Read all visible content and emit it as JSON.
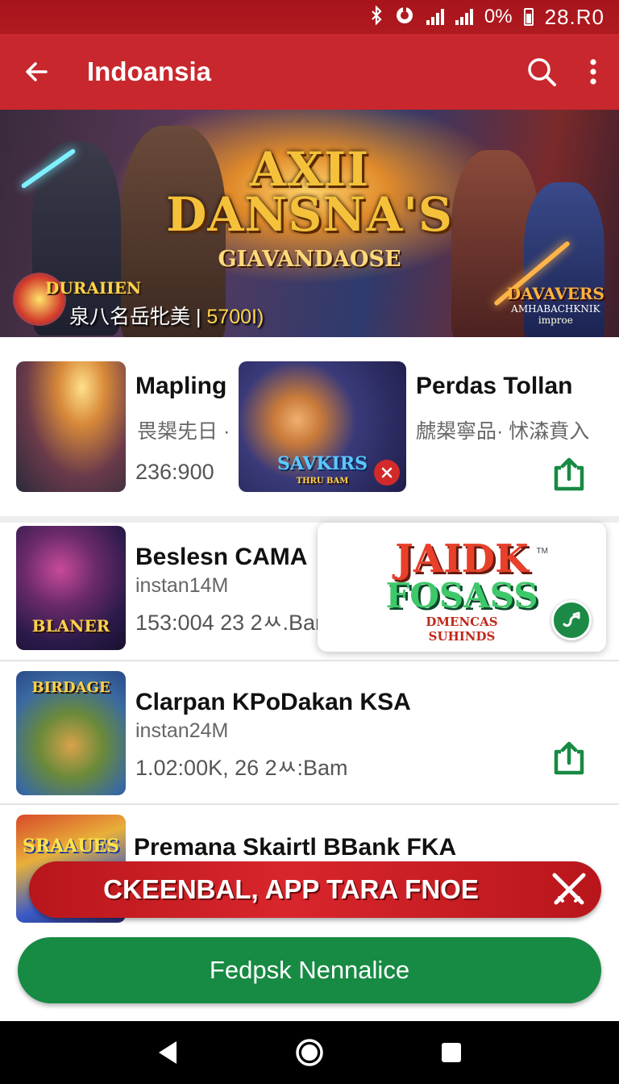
{
  "status_bar": {
    "battery": "0%",
    "time": "28.R0"
  },
  "app_bar": {
    "title": "Indoansia"
  },
  "hero": {
    "title_line1": "AXII",
    "title_line2": "DANSNA'S",
    "subtitle": "GIAVANDAOSE",
    "logo_text": "DURAIIEN",
    "caption_prefix": "泉八名岳牝美 | ",
    "caption_number": "5700I)",
    "right_logo_line1": "DAVAVERS",
    "right_logo_line2": "AMHABACHKNIK",
    "right_logo_line3": "improe"
  },
  "apps": [
    {
      "name": "Mapling",
      "sub": "畏槼兂日 ·",
      "meta": "236:900"
    },
    {
      "name": "Perdas Tollan",
      "sub": "虤槼寧品· 怵潹賁入",
      "thumb_label": "SAVKIRS",
      "thumb_sub": "THRU BAM"
    },
    {
      "name": "Beslesn CAMA",
      "sub": "instan14M",
      "meta": "153:004   23 2ㅆ.Bam",
      "thumb_label": "BLANER"
    },
    {
      "name": "Clarpan KPoDakan KSA",
      "sub": "instan24M",
      "meta": "1.02:00K, 26 2ㅆ:Bam",
      "thumb_label": "BIRDAGE"
    },
    {
      "name": "Premana Skairtl BBank FKA",
      "thumb_label": "SRAAUES"
    }
  ],
  "featured_card": {
    "logo_line1": "JAIDK",
    "logo_line2": "FOSASS",
    "logo_line3": "DMENCAS",
    "logo_line4": "SUHINDS",
    "tm": "TM"
  },
  "promo": {
    "text": "CKEENBAL, APP  TARA FNOE"
  },
  "primary_button": {
    "label": "Fedpsk Nennalice"
  },
  "colors": {
    "app_bar": "#c8272d",
    "status_bar": "#b01a20",
    "accent_green": "#178a43",
    "promo_red": "#c81e24"
  }
}
